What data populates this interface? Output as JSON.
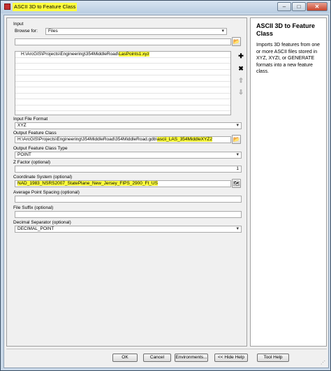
{
  "window": {
    "title": "ASCII 3D to Feature Class",
    "min_glyph": "–",
    "max_glyph": "□",
    "close_glyph": "✕"
  },
  "form": {
    "input_label": "Input",
    "browse_label": "Browse for:",
    "browse_value": "Files",
    "input_list": {
      "path_prefix": "H:\\ArcGIS\\Projects\\Engineering\\354MiddleRoad\\",
      "file_name": "LasPoints1.xyz"
    },
    "input_file_format_label": "Input File Format",
    "input_file_format_value": "XYZ",
    "output_feature_class_label": "Output Feature Class",
    "output_feature_class_prefix": "H:\\ArcGIS\\Projects\\Engineering\\354MiddleRoad\\354MiddleRoad.gdb\\",
    "output_feature_class_name": "ascii_LAS_354MiddleXYZ2",
    "output_feature_class_type_label": "Output Feature Class Type",
    "output_feature_class_type_value": "POINT",
    "z_factor_label": "Z Factor (optional)",
    "z_factor_value": "1",
    "coordinate_system_label": "Coordinate System (optional)",
    "coordinate_system_value": "NAD_1983_NSRS2007_StatePlane_New_Jersey_FIPS_2900_Ft_US",
    "avg_point_spacing_label": "Average Point Spacing (optional)",
    "avg_point_spacing_value": "",
    "file_suffix_label": "File Suffix (optional)",
    "file_suffix_value": "",
    "decimal_separator_label": "Decimal Separator (optional)",
    "decimal_separator_value": "DECIMAL_POINT"
  },
  "help": {
    "title": "ASCII 3D to Feature Class",
    "text": "Imports 3D features from one or more ASCII files stored in XYZ, XYZI, or GENERATE formats into a new feature class."
  },
  "buttons": {
    "ok": "OK",
    "cancel": "Cancel",
    "environments": "Environments...",
    "hide_help": "<< Hide Help",
    "tool_help": "Tool Help"
  },
  "icons": {
    "folder": "folder-open-icon",
    "add": "plus-icon",
    "remove": "x-icon",
    "up": "arrow-up-icon",
    "down": "arrow-down-icon",
    "spatial_ref": "spatial-reference-icon",
    "app": "toolbox-icon"
  },
  "colors": {
    "highlight": "#ffff3c",
    "titlebar": "#c9d8e8"
  }
}
